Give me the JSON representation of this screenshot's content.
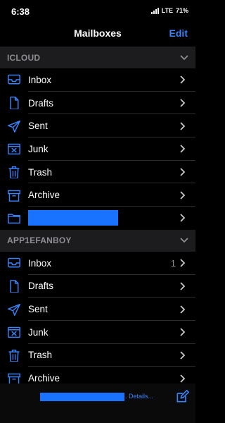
{
  "status": {
    "time": "6:38",
    "network": "LTE",
    "battery": "71%"
  },
  "nav": {
    "title": "Mailboxes",
    "edit": "Edit"
  },
  "sections": [
    {
      "title": "ICLOUD",
      "items": [
        {
          "icon": "inbox-icon",
          "label": "Inbox",
          "count": ""
        },
        {
          "icon": "document-icon",
          "label": "Drafts",
          "count": ""
        },
        {
          "icon": "paper-plane-icon",
          "label": "Sent",
          "count": ""
        },
        {
          "icon": "junk-icon",
          "label": "Junk",
          "count": ""
        },
        {
          "icon": "trash-icon",
          "label": "Trash",
          "count": ""
        },
        {
          "icon": "archive-icon",
          "label": "Archive",
          "count": ""
        },
        {
          "icon": "folder-icon",
          "label": "",
          "count": "",
          "redacted": true
        }
      ]
    },
    {
      "title": "APP1EFANBOY",
      "items": [
        {
          "icon": "inbox-icon",
          "label": "Inbox",
          "count": "1"
        },
        {
          "icon": "document-icon",
          "label": "Drafts",
          "count": ""
        },
        {
          "icon": "paper-plane-icon",
          "label": "Sent",
          "count": ""
        },
        {
          "icon": "junk-icon",
          "label": "Junk",
          "count": ""
        },
        {
          "icon": "trash-icon",
          "label": "Trash",
          "count": ""
        },
        {
          "icon": "archive-icon",
          "label": "Archive",
          "count": ""
        }
      ]
    }
  ],
  "bottom": {
    "details": ". Details..."
  },
  "colors": {
    "accent": "#3a83f7",
    "redaction": "#1a73ff"
  }
}
